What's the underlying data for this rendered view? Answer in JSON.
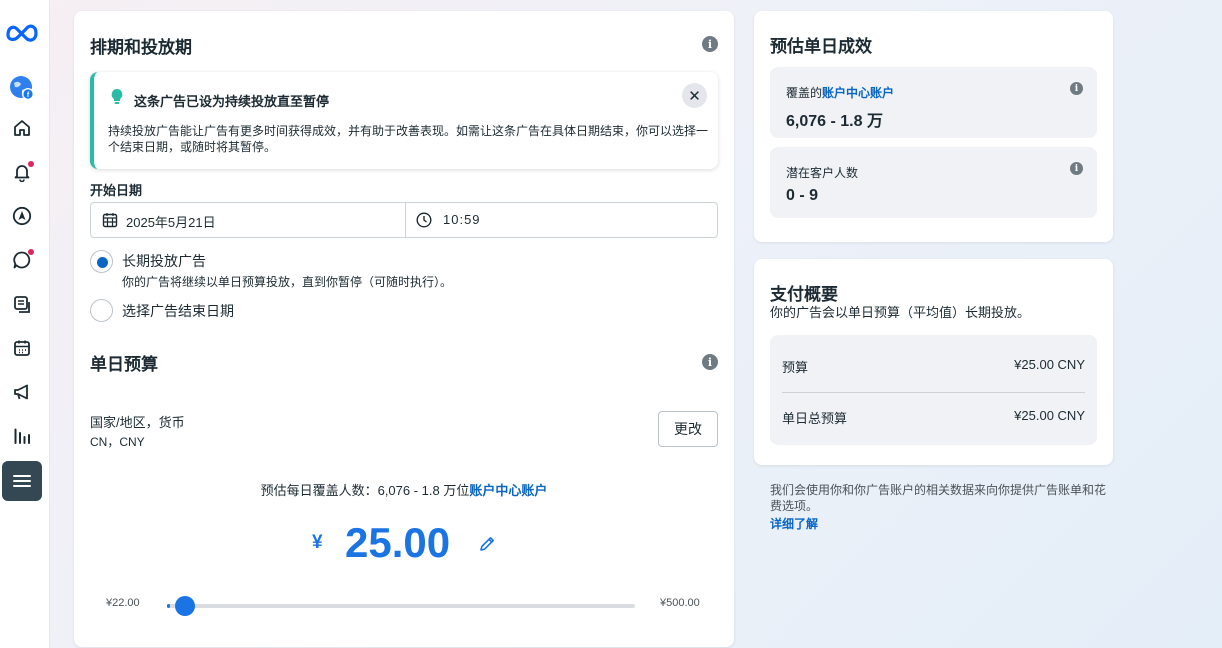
{
  "sidebar": {
    "items": [
      "meta-logo",
      "business-globe",
      "home",
      "notifications",
      "navigate",
      "messages",
      "pages",
      "calendar",
      "ads",
      "insights",
      "menu"
    ]
  },
  "schedule": {
    "title": "排期和投放期",
    "notice_title": "这条广告已设为持续投放直至暂停",
    "notice_body": "持续投放广告能让广告有更多时间获得成效，并有助于改善表现。如需让这条广告在具体日期结束，你可以选择一个结束日期，或随时将其暂停。",
    "start_label": "开始日期",
    "start_date": "2025年5月21日",
    "start_time": "10:59",
    "option_long_label": "长期投放广告",
    "option_long_sub": "你的广告将继续以单日预算投放，直到你暂停（可随时执行）。",
    "option_end_label": "选择广告结束日期"
  },
  "budget": {
    "title": "单日预算",
    "country_label": "国家/地区，货币",
    "country_value": "CN，CNY",
    "change_button": "更改",
    "reach_prefix": "预估每日覆盖人数：6,076 - 1.8 万位",
    "reach_link": "账户中心账户",
    "currency_symbol": "¥",
    "amount": "25.00",
    "slider_min": "¥22.00",
    "slider_max": "¥500.00",
    "slider_value": 25,
    "slider_min_value": 22,
    "slider_max_value": 500
  },
  "estimate": {
    "title": "预估单日成效",
    "reach_prefix": "覆盖的",
    "reach_link": "账户中心账户",
    "reach_value": "6,076 - 1.8 万",
    "potential_label": "潜在客户人数",
    "potential_value": "0 - 9"
  },
  "payment": {
    "title": "支付概要",
    "subtitle": "你的广告会以单日预算（平均值）长期投放。",
    "budget_label": "预算",
    "budget_value": "¥25.00 CNY",
    "daily_total_label": "单日总预算",
    "daily_total_value": "¥25.00 CNY"
  },
  "footer": {
    "note": "我们会使用你和你广告账户的相关数据来向你提供广告账单和花费选项。",
    "learn_more": "详细了解"
  },
  "colors": {
    "accent": "#1b74e4",
    "notice_stripe": "#2abba7",
    "notification_dot": "#e0245e"
  }
}
